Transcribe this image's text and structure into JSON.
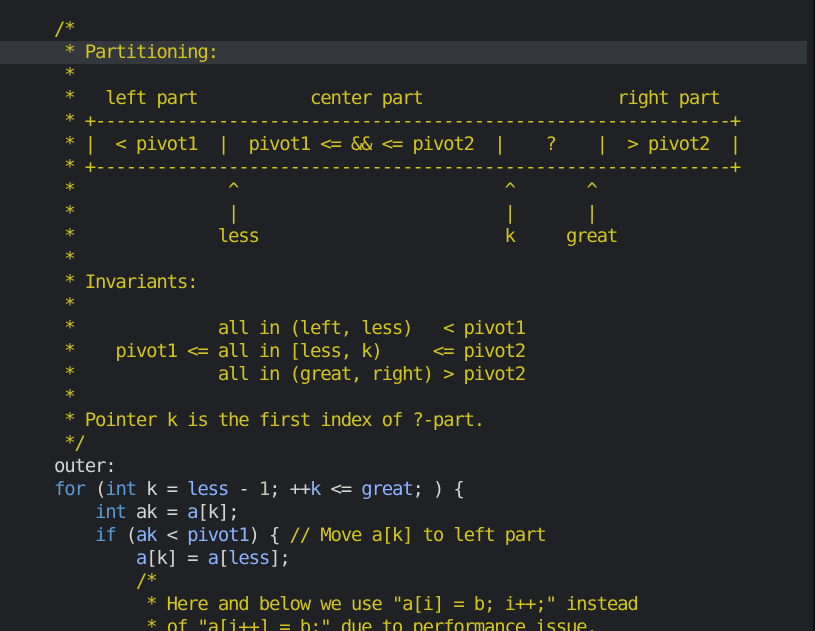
{
  "editor": {
    "current_line_index": 1,
    "lines": [
      [
        {
          "t": "/*",
          "c": "cm"
        }
      ],
      [
        {
          "t": " * Partitioning:",
          "c": "cm"
        }
      ],
      [
        {
          "t": " *",
          "c": "cm"
        }
      ],
      [
        {
          "t": " *   left part           center part                   right part",
          "c": "cm"
        }
      ],
      [
        {
          "t": " * +--------------------------------------------------------------+",
          "c": "cm"
        }
      ],
      [
        {
          "t": " * |  < pivot1  |  pivot1 <= && <= pivot2  |    ?    |  > pivot2  |",
          "c": "cm"
        }
      ],
      [
        {
          "t": " * +--------------------------------------------------------------+",
          "c": "cm"
        }
      ],
      [
        {
          "t": " *               ^                          ^       ^",
          "c": "cm"
        }
      ],
      [
        {
          "t": " *               |                          |       |",
          "c": "cm"
        }
      ],
      [
        {
          "t": " *              less                        k     great",
          "c": "cm"
        }
      ],
      [
        {
          "t": " *",
          "c": "cm"
        }
      ],
      [
        {
          "t": " * Invariants:",
          "c": "cm"
        }
      ],
      [
        {
          "t": " *",
          "c": "cm"
        }
      ],
      [
        {
          "t": " *              all in (left, less)   < pivot1",
          "c": "cm"
        }
      ],
      [
        {
          "t": " *    pivot1 <= all in [less, k)     <= pivot2",
          "c": "cm"
        }
      ],
      [
        {
          "t": " *              all in (great, right) > pivot2",
          "c": "cm"
        }
      ],
      [
        {
          "t": " *",
          "c": "cm"
        }
      ],
      [
        {
          "t": " * Pointer k is the first index of ?-part.",
          "c": "cm"
        }
      ],
      [
        {
          "t": " */",
          "c": "cm"
        }
      ],
      [
        {
          "t": "outer:",
          "c": "pl"
        }
      ],
      [
        {
          "t": "for",
          "c": "kw"
        },
        {
          "t": " (",
          "c": "pl"
        },
        {
          "t": "int",
          "c": "kw"
        },
        {
          "t": " k = ",
          "c": "pl"
        },
        {
          "t": "less",
          "c": "fn"
        },
        {
          "t": " - ",
          "c": "pl"
        },
        {
          "t": "1",
          "c": "num"
        },
        {
          "t": "; ++",
          "c": "pl"
        },
        {
          "t": "k",
          "c": "fn"
        },
        {
          "t": " <= ",
          "c": "pl"
        },
        {
          "t": "great",
          "c": "fn"
        },
        {
          "t": "; ) {",
          "c": "pl"
        }
      ],
      [
        {
          "t": "    ",
          "c": "pl"
        },
        {
          "t": "int",
          "c": "kw"
        },
        {
          "t": " ak = ",
          "c": "pl"
        },
        {
          "t": "a",
          "c": "fn"
        },
        {
          "t": "[k];",
          "c": "pl"
        }
      ],
      [
        {
          "t": "    ",
          "c": "pl"
        },
        {
          "t": "if",
          "c": "kw"
        },
        {
          "t": " (",
          "c": "pl"
        },
        {
          "t": "ak",
          "c": "fn"
        },
        {
          "t": " < ",
          "c": "pl"
        },
        {
          "t": "pivot1",
          "c": "fn"
        },
        {
          "t": ") { ",
          "c": "pl"
        },
        {
          "t": "// Move a[k] to left part",
          "c": "cm"
        }
      ],
      [
        {
          "t": "        ",
          "c": "pl"
        },
        {
          "t": "a",
          "c": "fn"
        },
        {
          "t": "[k] = ",
          "c": "pl"
        },
        {
          "t": "a",
          "c": "fn"
        },
        {
          "t": "[",
          "c": "pl"
        },
        {
          "t": "less",
          "c": "fn"
        },
        {
          "t": "];",
          "c": "pl"
        }
      ],
      [
        {
          "t": "        /*",
          "c": "cm"
        }
      ],
      [
        {
          "t": "         * Here and below we use \"a[i] = b; i++;\" instead",
          "c": "cm"
        }
      ],
      [
        {
          "t": "         * of \"a[i++] = b;\" due to performance issue.",
          "c": "cm"
        }
      ]
    ]
  }
}
